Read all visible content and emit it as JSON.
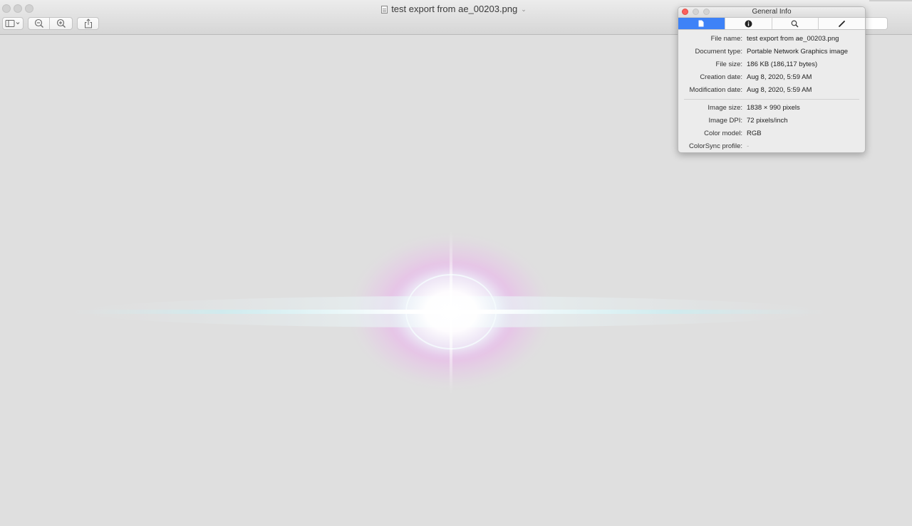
{
  "window": {
    "title": "test export from ae_00203.png",
    "icons": [
      "sidebar-icon",
      "zoom-out-icon",
      "zoom-in-icon",
      "share-icon"
    ]
  },
  "inspector": {
    "title": "General Info",
    "tabs": [
      "general-info-icon",
      "more-info-icon",
      "keywords-icon",
      "annotations-icon"
    ],
    "rows": [
      {
        "label": "File name:",
        "value": "test export from ae_00203.png"
      },
      {
        "label": "Document type:",
        "value": "Portable Network Graphics image"
      },
      {
        "label": "File size:",
        "value": "186 KB (186,117 bytes)"
      },
      {
        "label": "Creation date:",
        "value": "Aug 8, 2020, 5:59 AM"
      },
      {
        "label": "Modification date:",
        "value": "Aug 8, 2020, 5:59 AM"
      }
    ],
    "rows2": [
      {
        "label": "Image size:",
        "value": "1838 × 990 pixels"
      },
      {
        "label": "Image DPI:",
        "value": "72 pixels/inch"
      },
      {
        "label": "Color model:",
        "value": "RGB"
      },
      {
        "label": "ColorSync profile:",
        "value": "-"
      }
    ],
    "active_tab_color": "#3e82f7",
    "close_color": "#fc605b"
  }
}
